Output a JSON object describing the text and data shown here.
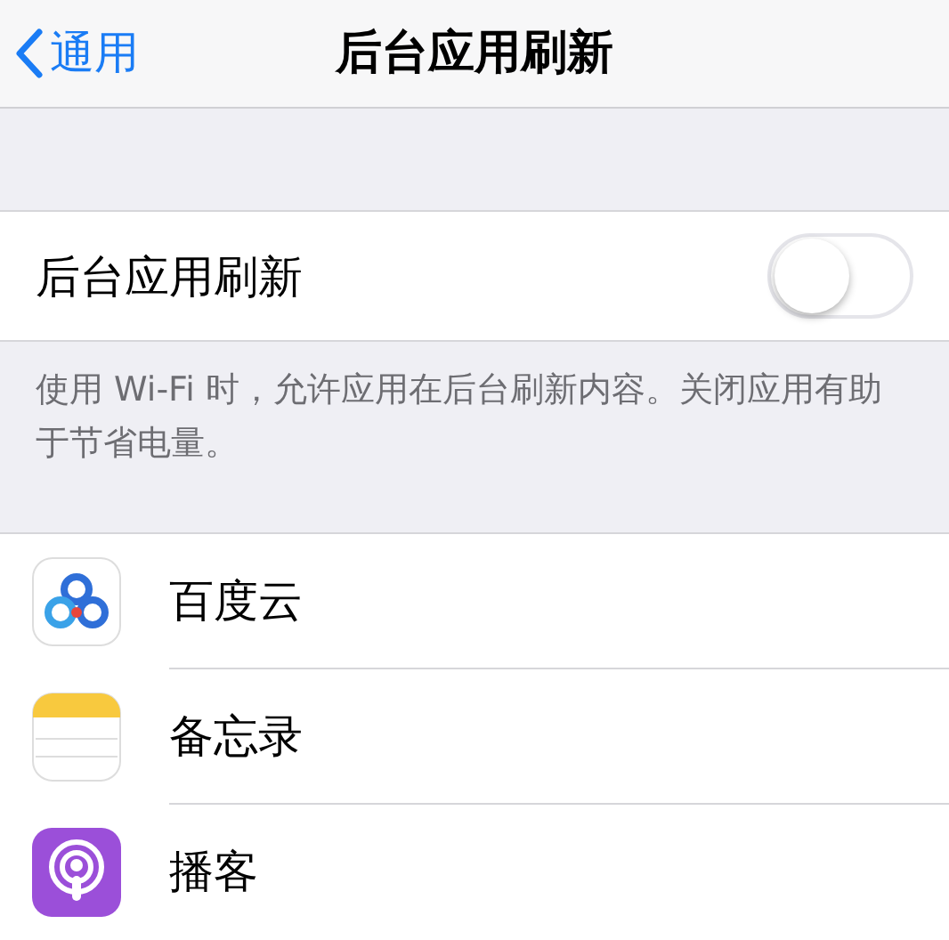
{
  "nav": {
    "back": "通用",
    "title": "后台应用刷新"
  },
  "main_toggle": {
    "label": "后台应用刷新",
    "on": false
  },
  "description": "使用 Wi-Fi 时，允许应用在后台刷新内容。关闭应用有助于节省电量。",
  "apps": [
    {
      "name": "百度云",
      "kind": "cloud"
    },
    {
      "name": "备忘录",
      "kind": "notes"
    },
    {
      "name": "播客",
      "kind": "podcast"
    }
  ]
}
